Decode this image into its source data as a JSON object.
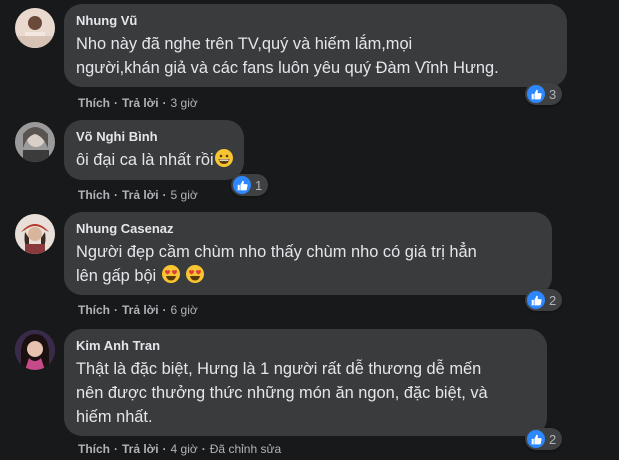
{
  "comments": [
    {
      "author": "Nhung Vũ",
      "lines": [
        "Nho này đã nghe trên TV,quý và hiếm lắm,mọi",
        "người,khán giả và các fans luôn yêu quý Đàm Vĩnh Hưng."
      ],
      "like_label": "Thích",
      "reply_label": "Trả lời",
      "time": "3 giờ",
      "reaction_count": "3"
    },
    {
      "author": "Võ Nghi Bình",
      "lines": [
        "ôi đại ca là nhất rồi"
      ],
      "like_label": "Thích",
      "reply_label": "Trả lời",
      "time": "5 giờ",
      "reaction_count": "1",
      "emoji": "grinning-face"
    },
    {
      "author": "Nhung Casenaz",
      "lines": [
        "Người đẹp cầm chùm nho thấy chùm nho có giá trị hẳn",
        "lên gấp bội"
      ],
      "like_label": "Thích",
      "reply_label": "Trả lời",
      "time": "6 giờ",
      "reaction_count": "2",
      "emoji": "heart-eyes-face"
    },
    {
      "author": "Kim Anh Tran",
      "lines": [
        "Thật là đặc biệt, Hưng là 1 người rất dễ thương dễ mến",
        "nên được thưởng thức những món ăn ngon, đặc biệt, và",
        "hiếm nhất."
      ],
      "like_label": "Thích",
      "reply_label": "Trả lời",
      "time": "4 giờ",
      "edited_label": "Đã chỉnh sửa",
      "reaction_count": "2"
    }
  ],
  "colors": {
    "background": "#18191a",
    "bubble": "#3a3b3c",
    "text": "#e4e6eb",
    "secondary": "#b0b3b8",
    "like_blue": "#2d88ff"
  },
  "icons": {
    "reaction": "like-thumbs-up-icon"
  }
}
